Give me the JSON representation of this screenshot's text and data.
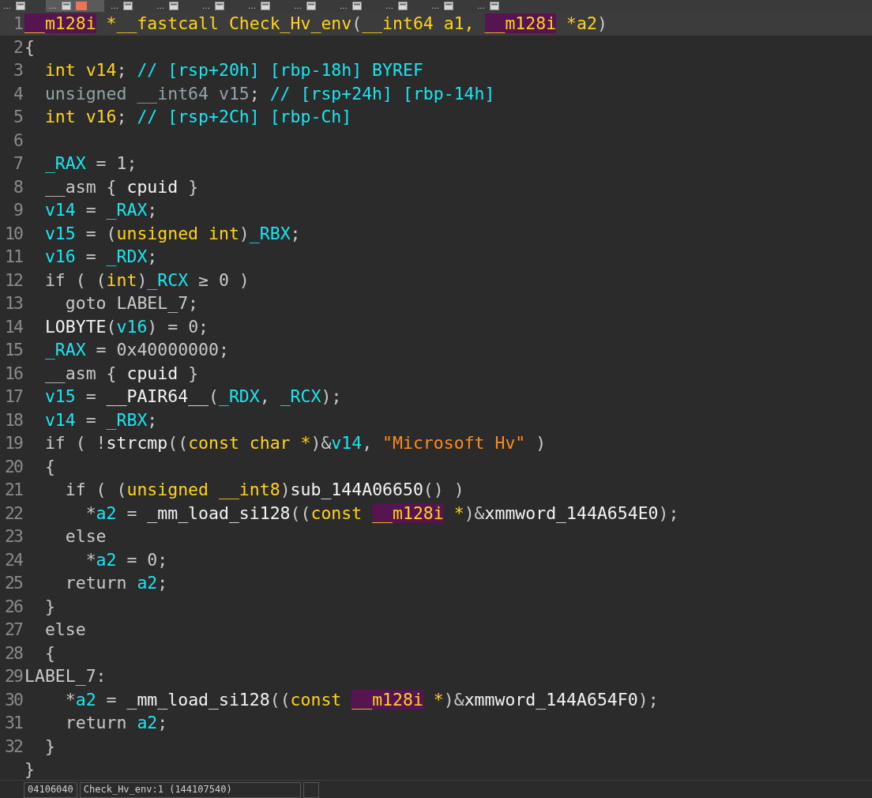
{
  "tabs": [
    {
      "label": "…",
      "selected": false
    },
    {
      "label": "…",
      "selected": true
    },
    {
      "label": "…",
      "selected": false
    },
    {
      "label": "…",
      "selected": false
    },
    {
      "label": "…",
      "selected": false
    },
    {
      "label": "…",
      "selected": false
    },
    {
      "label": "…",
      "selected": false
    },
    {
      "label": "…",
      "selected": false
    },
    {
      "label": "…",
      "selected": false
    },
    {
      "label": "…",
      "selected": false
    },
    {
      "label": "…",
      "selected": false
    }
  ],
  "code_lines": [
    {
      "num": "1",
      "current": true,
      "tokens": [
        {
          "kind": "h",
          "t": "__m128i"
        },
        {
          "kind": "y",
          "t": " *__fastcall Check_Hv_env"
        },
        {
          "kind": "p",
          "t": "("
        },
        {
          "kind": "y",
          "t": "__int64 a1, "
        },
        {
          "kind": "h",
          "t": "__m128i"
        },
        {
          "kind": "y",
          "t": " *a2"
        },
        {
          "kind": "p",
          "t": ")"
        }
      ]
    },
    {
      "num": "2",
      "current": false,
      "tokens": [
        {
          "kind": "p",
          "t": "{"
        }
      ]
    },
    {
      "num": "3",
      "current": false,
      "tokens": [
        {
          "kind": "y",
          "t": "  int v14"
        },
        {
          "kind": "p",
          "t": "; "
        },
        {
          "kind": "c",
          "t": "// [rsp+20h] [rbp-18h] BYREF"
        }
      ]
    },
    {
      "num": "4",
      "current": false,
      "tokens": [
        {
          "kind": "t",
          "t": "  unsigned __int64 v15"
        },
        {
          "kind": "p",
          "t": "; "
        },
        {
          "kind": "c",
          "t": "// [rsp+24h] [rbp-14h]"
        }
      ]
    },
    {
      "num": "5",
      "current": false,
      "tokens": [
        {
          "kind": "y",
          "t": "  int v16"
        },
        {
          "kind": "p",
          "t": "; "
        },
        {
          "kind": "c",
          "t": "// [rsp+2Ch] [rbp-Ch]"
        }
      ]
    },
    {
      "num": "6",
      "current": false
    },
    {
      "num": "7",
      "current": false,
      "tokens": [
        {
          "kind": "c",
          "t": "  _RAX"
        },
        {
          "kind": "p",
          "t": " = 1;"
        }
      ]
    },
    {
      "num": "8",
      "current": false,
      "tokens": [
        {
          "kind": "p",
          "t": "  __asm { "
        },
        {
          "kind": "w",
          "t": "cpuid"
        },
        {
          "kind": "p",
          "t": " }"
        }
      ]
    },
    {
      "num": "9",
      "current": false,
      "tokens": [
        {
          "kind": "c",
          "t": "  v14"
        },
        {
          "kind": "p",
          "t": " = "
        },
        {
          "kind": "c",
          "t": "_RAX"
        },
        {
          "kind": "p",
          "t": ";"
        }
      ]
    },
    {
      "num": "10",
      "current": false,
      "tokens": [
        {
          "kind": "c",
          "t": "  v15"
        },
        {
          "kind": "p",
          "t": " = ("
        },
        {
          "kind": "y",
          "t": "unsigned int"
        },
        {
          "kind": "p",
          "t": ")"
        },
        {
          "kind": "c",
          "t": "_RBX"
        },
        {
          "kind": "p",
          "t": ";"
        }
      ]
    },
    {
      "num": "11",
      "current": false,
      "tokens": [
        {
          "kind": "c",
          "t": "  v16"
        },
        {
          "kind": "p",
          "t": " = "
        },
        {
          "kind": "c",
          "t": "_RDX"
        },
        {
          "kind": "p",
          "t": ";"
        }
      ]
    },
    {
      "num": "12",
      "current": false,
      "tokens": [
        {
          "kind": "p",
          "t": "  if ( ("
        },
        {
          "kind": "y",
          "t": "int"
        },
        {
          "kind": "p",
          "t": ")"
        },
        {
          "kind": "c",
          "t": "_RCX"
        },
        {
          "kind": "p",
          "t": " ≥ 0 )"
        }
      ]
    },
    {
      "num": "13",
      "current": false,
      "tokens": [
        {
          "kind": "p",
          "t": "    goto LABEL_7;"
        }
      ]
    },
    {
      "num": "14",
      "current": false,
      "tokens": [
        {
          "kind": "w",
          "t": "  LOBYTE"
        },
        {
          "kind": "p",
          "t": "("
        },
        {
          "kind": "c",
          "t": "v16"
        },
        {
          "kind": "p",
          "t": ") = 0;"
        }
      ]
    },
    {
      "num": "15",
      "current": false,
      "tokens": [
        {
          "kind": "c",
          "t": "  _RAX"
        },
        {
          "kind": "p",
          "t": " = 0x40000000;"
        }
      ]
    },
    {
      "num": "16",
      "current": false,
      "tokens": [
        {
          "kind": "p",
          "t": "  __asm { "
        },
        {
          "kind": "w",
          "t": "cpuid"
        },
        {
          "kind": "p",
          "t": " }"
        }
      ]
    },
    {
      "num": "17",
      "current": false,
      "tokens": [
        {
          "kind": "c",
          "t": "  v15"
        },
        {
          "kind": "p",
          "t": " = "
        },
        {
          "kind": "w",
          "t": "__PAIR64__"
        },
        {
          "kind": "p",
          "t": "("
        },
        {
          "kind": "c",
          "t": "_RDX"
        },
        {
          "kind": "p",
          "t": ", "
        },
        {
          "kind": "c",
          "t": "_RCX"
        },
        {
          "kind": "p",
          "t": ");"
        }
      ]
    },
    {
      "num": "18",
      "current": false,
      "tokens": [
        {
          "kind": "c",
          "t": "  v14"
        },
        {
          "kind": "p",
          "t": " = "
        },
        {
          "kind": "c",
          "t": "_RBX"
        },
        {
          "kind": "p",
          "t": ";"
        }
      ]
    },
    {
      "num": "19",
      "current": false,
      "tokens": [
        {
          "kind": "p",
          "t": "  if ( !"
        },
        {
          "kind": "w",
          "t": "strcmp"
        },
        {
          "kind": "p",
          "t": "(("
        },
        {
          "kind": "y",
          "t": "const char *"
        },
        {
          "kind": "p",
          "t": ")&"
        },
        {
          "kind": "c",
          "t": "v14"
        },
        {
          "kind": "p",
          "t": ", "
        },
        {
          "kind": "s",
          "t": "\"Microsoft Hv\""
        },
        {
          "kind": "p",
          "t": " )"
        }
      ]
    },
    {
      "num": "20",
      "current": false,
      "tokens": [
        {
          "kind": "p",
          "t": "  {"
        }
      ]
    },
    {
      "num": "21",
      "current": false,
      "tokens": [
        {
          "kind": "p",
          "t": "    if ( ("
        },
        {
          "kind": "y",
          "t": "unsigned __int8"
        },
        {
          "kind": "p",
          "t": ")"
        },
        {
          "kind": "w",
          "t": "sub_144A06650"
        },
        {
          "kind": "p",
          "t": "() )"
        }
      ]
    },
    {
      "num": "22",
      "current": false,
      "tokens": [
        {
          "kind": "p",
          "t": "      *"
        },
        {
          "kind": "c",
          "t": "a2"
        },
        {
          "kind": "p",
          "t": " = "
        },
        {
          "kind": "w",
          "t": "_mm_load_si128"
        },
        {
          "kind": "p",
          "t": "(("
        },
        {
          "kind": "y",
          "t": "const "
        },
        {
          "kind": "h",
          "t": "__m128i"
        },
        {
          "kind": "y",
          "t": " *"
        },
        {
          "kind": "p",
          "t": ")&"
        },
        {
          "kind": "w",
          "t": "xmmword_144A654E0"
        },
        {
          "kind": "p",
          "t": ");"
        }
      ]
    },
    {
      "num": "23",
      "current": false,
      "tokens": [
        {
          "kind": "p",
          "t": "    else"
        }
      ]
    },
    {
      "num": "24",
      "current": false,
      "tokens": [
        {
          "kind": "p",
          "t": "      *"
        },
        {
          "kind": "c",
          "t": "a2"
        },
        {
          "kind": "p",
          "t": " = 0;"
        }
      ]
    },
    {
      "num": "25",
      "current": false,
      "tokens": [
        {
          "kind": "p",
          "t": "    return "
        },
        {
          "kind": "c",
          "t": "a2"
        },
        {
          "kind": "p",
          "t": ";"
        }
      ]
    },
    {
      "num": "26",
      "current": false,
      "tokens": [
        {
          "kind": "p",
          "t": "  }"
        }
      ]
    },
    {
      "num": "27",
      "current": false,
      "tokens": [
        {
          "kind": "p",
          "t": "  else"
        }
      ]
    },
    {
      "num": "28",
      "current": false,
      "tokens": [
        {
          "kind": "p",
          "t": "  {"
        }
      ]
    },
    {
      "num": "29",
      "current": false,
      "tokens": [
        {
          "kind": "p",
          "t": "LABEL_7:"
        }
      ]
    },
    {
      "num": "30",
      "current": false,
      "tokens": [
        {
          "kind": "p",
          "t": "    *"
        },
        {
          "kind": "c",
          "t": "a2"
        },
        {
          "kind": "p",
          "t": " = "
        },
        {
          "kind": "w",
          "t": "_mm_load_si128"
        },
        {
          "kind": "p",
          "t": "(("
        },
        {
          "kind": "y",
          "t": "const "
        },
        {
          "kind": "h",
          "t": "__m128i"
        },
        {
          "kind": "y",
          "t": " *"
        },
        {
          "kind": "p",
          "t": ")&"
        },
        {
          "kind": "w",
          "t": "xmmword_144A654F0"
        },
        {
          "kind": "p",
          "t": ");"
        }
      ]
    },
    {
      "num": "31",
      "current": false,
      "tokens": [
        {
          "kind": "p",
          "t": "    return "
        },
        {
          "kind": "c",
          "t": "a2"
        },
        {
          "kind": "p",
          "t": ";"
        }
      ]
    },
    {
      "num": "32",
      "current": false,
      "tokens": [
        {
          "kind": "p",
          "t": "  }"
        }
      ]
    },
    {
      "current": false,
      "tokens": [
        {
          "kind": "p",
          "t": "}"
        }
      ]
    }
  ],
  "status_bar": {
    "address": "04106040",
    "location": "Check_Hv_env:1 (144107540)"
  }
}
